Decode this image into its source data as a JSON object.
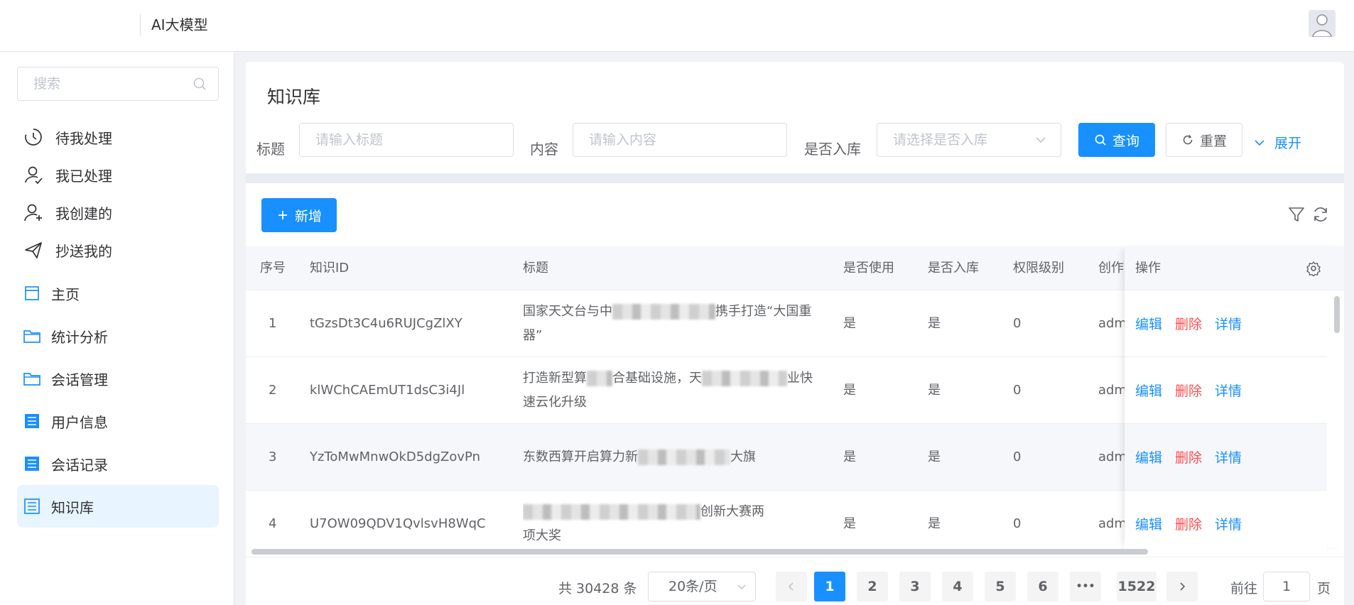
{
  "header": {
    "app_title": "AI大模型"
  },
  "sidebar": {
    "search_placeholder": "搜索",
    "todo_items": [
      {
        "label": "待我处理",
        "icon": "clock-icon"
      },
      {
        "label": "我已处理",
        "icon": "user-check-icon"
      },
      {
        "label": "我创建的",
        "icon": "user-plus-icon"
      },
      {
        "label": "抄送我的",
        "icon": "send-icon"
      }
    ],
    "nav_items": [
      {
        "label": "主页",
        "icon": "calendar-icon"
      },
      {
        "label": "统计分析",
        "icon": "folder-icon"
      },
      {
        "label": "会话管理",
        "icon": "folder-icon"
      },
      {
        "label": "用户信息",
        "icon": "list-icon"
      },
      {
        "label": "会话记录",
        "icon": "list-icon"
      },
      {
        "label": "知识库",
        "icon": "list-icon"
      }
    ],
    "active": "知识库"
  },
  "filter": {
    "page_title": "知识库",
    "title_label": "标题",
    "title_placeholder": "请输入标题",
    "content_label": "内容",
    "content_placeholder": "请输入内容",
    "stored_label": "是否入库",
    "stored_placeholder": "请选择是否入库",
    "query_button": "查询",
    "reset_button": "重置",
    "expand_link": "展开"
  },
  "toolbar": {
    "add_button": "新增"
  },
  "table": {
    "columns": [
      "序号",
      "知识ID",
      "标题",
      "是否使用",
      "是否入库",
      "权限级别",
      "创作者",
      "操作"
    ],
    "rows": [
      {
        "index": "1",
        "id": "tGzsDt3C4u6RUJCgZlXY",
        "title_a": "国家天文台与中",
        "title_b": "携手打造“大国重器”",
        "used": "是",
        "stored": "是",
        "level": "0",
        "creator": "admin"
      },
      {
        "index": "2",
        "id": "klWChCAEmUT1dsC3i4Jl",
        "title_a": "打造新型算",
        "title_b": "合基础设施，天",
        "title_c": "业快",
        "title_d": "速云化升级",
        "used": "是",
        "stored": "是",
        "level": "0",
        "creator": "admin"
      },
      {
        "index": "3",
        "id": "YzToMwMnwOkD5dgZovPn",
        "title_a": "东数西算开启算力新",
        "title_b": "大旗",
        "used": "是",
        "stored": "是",
        "level": "0",
        "creator": "admin"
      },
      {
        "index": "4",
        "id": "U7OW09QDV1QvlsvH8WqC",
        "title_a": "创新大赛两",
        "title_b": "项大奖",
        "used": "是",
        "stored": "是",
        "level": "0",
        "creator": "admin"
      }
    ],
    "ops": {
      "edit": "编辑",
      "delete": "删除",
      "detail": "详情"
    }
  },
  "pagination": {
    "total": "共 30428 条",
    "page_size": "20条/页",
    "pages": [
      "1",
      "2",
      "3",
      "4",
      "5",
      "6"
    ],
    "ellipsis": "•••",
    "last_page": "1522",
    "current": "1",
    "goto_label": "前往",
    "goto_value": "1",
    "page_unit": "页"
  },
  "colors": {
    "primary": "#1890ff",
    "danger": "#ff4d4f",
    "active_bg": "#e8f4ff"
  }
}
